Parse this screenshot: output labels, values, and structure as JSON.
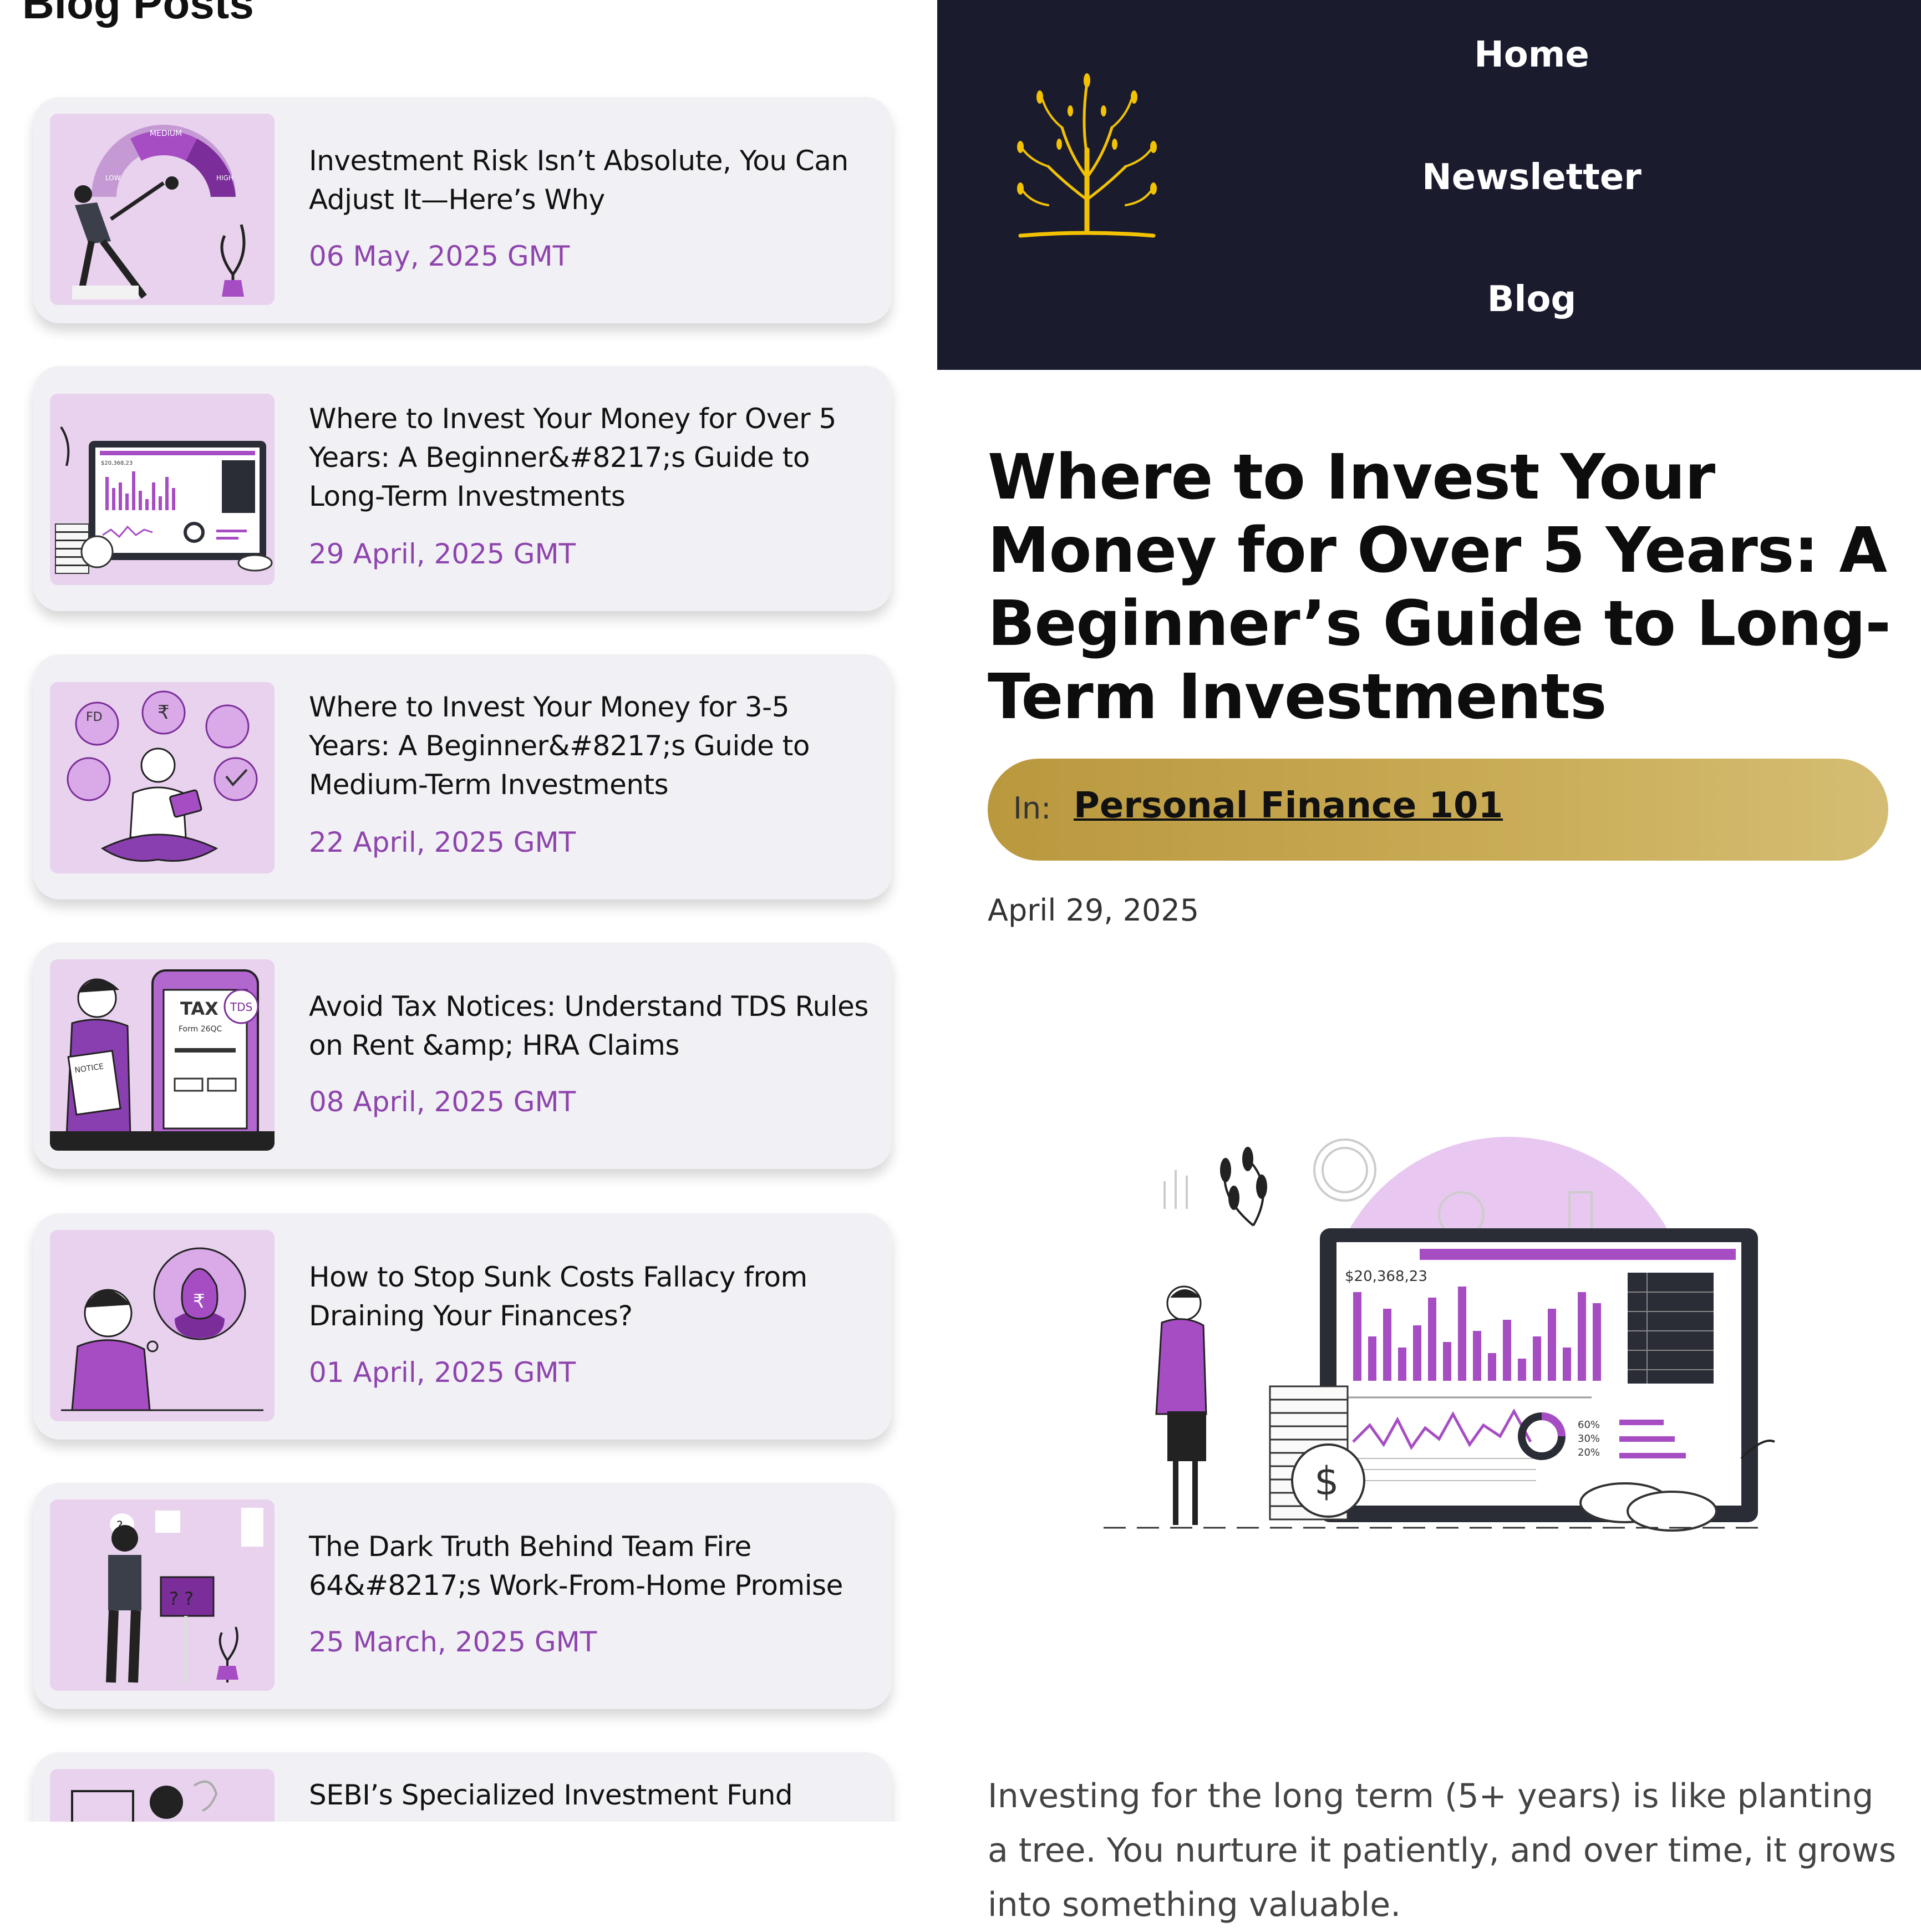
{
  "blog_list": {
    "title": "Blog Posts",
    "posts": [
      {
        "title": "Investment Risk Isn’t Absolute, You Can Adjust It—Here’s Why",
        "date": "06 May, 2025 GMT"
      },
      {
        "title": "Where to Invest Your Money for Over 5 Years: A Beginner&#8217;s Guide to Long-Term Investments",
        "date": "29 April, 2025 GMT"
      },
      {
        "title": "Where to Invest Your Money for 3-5 Years: A Beginner&#8217;s Guide to Medium-Term Investments",
        "date": "22 April, 2025 GMT"
      },
      {
        "title": "Avoid Tax Notices: Understand TDS Rules on Rent &amp; HRA Claims",
        "date": "08 April, 2025 GMT"
      },
      {
        "title": "How to Stop Sunk Costs Fallacy from Draining Your Finances?",
        "date": "01 April, 2025 GMT"
      },
      {
        "title": "The Dark Truth Behind Team Fire 64&#8217;s Work-From-Home Promise",
        "date": "25 March, 2025 GMT"
      },
      {
        "title": "SEBI’s Specialized Investment Fund",
        "date": ""
      }
    ]
  },
  "nav": {
    "home": "Home",
    "newsletter": "Newsletter",
    "blog": "Blog"
  },
  "article": {
    "title": "Where to Invest Your Money for Over 5 Years: A Beginner’s Guide to Long-Term Investments",
    "category_prefix": "In:",
    "category": "Personal Finance 101",
    "date": "April 29, 2025",
    "body": "Investing for the long term (5+ years) is like planting a tree. You nurture it patiently, and over time, it grows into something valuable."
  },
  "illustration_text": {
    "gauge_medium": "MEDIUM",
    "gauge_low": "LOW",
    "gauge_high": "HIGH",
    "dashboard_amount": "$20,368,23",
    "legend_1": "60%",
    "legend_2": "30%",
    "legend_3": "20%",
    "fd_badge": "FD",
    "tax_label": "TAX",
    "tds_label": "TDS",
    "form_label": "Form 26QC",
    "notice_label": "NOTICE"
  },
  "colors": {
    "navbar": "#1a1c2e",
    "date_purple": "#8e44ad",
    "illustration_purple": "#a64dc4",
    "thumb_bg": "#e8d2ee",
    "pill_gold": "#c9ab55",
    "logo_gold": "#f2c200"
  }
}
